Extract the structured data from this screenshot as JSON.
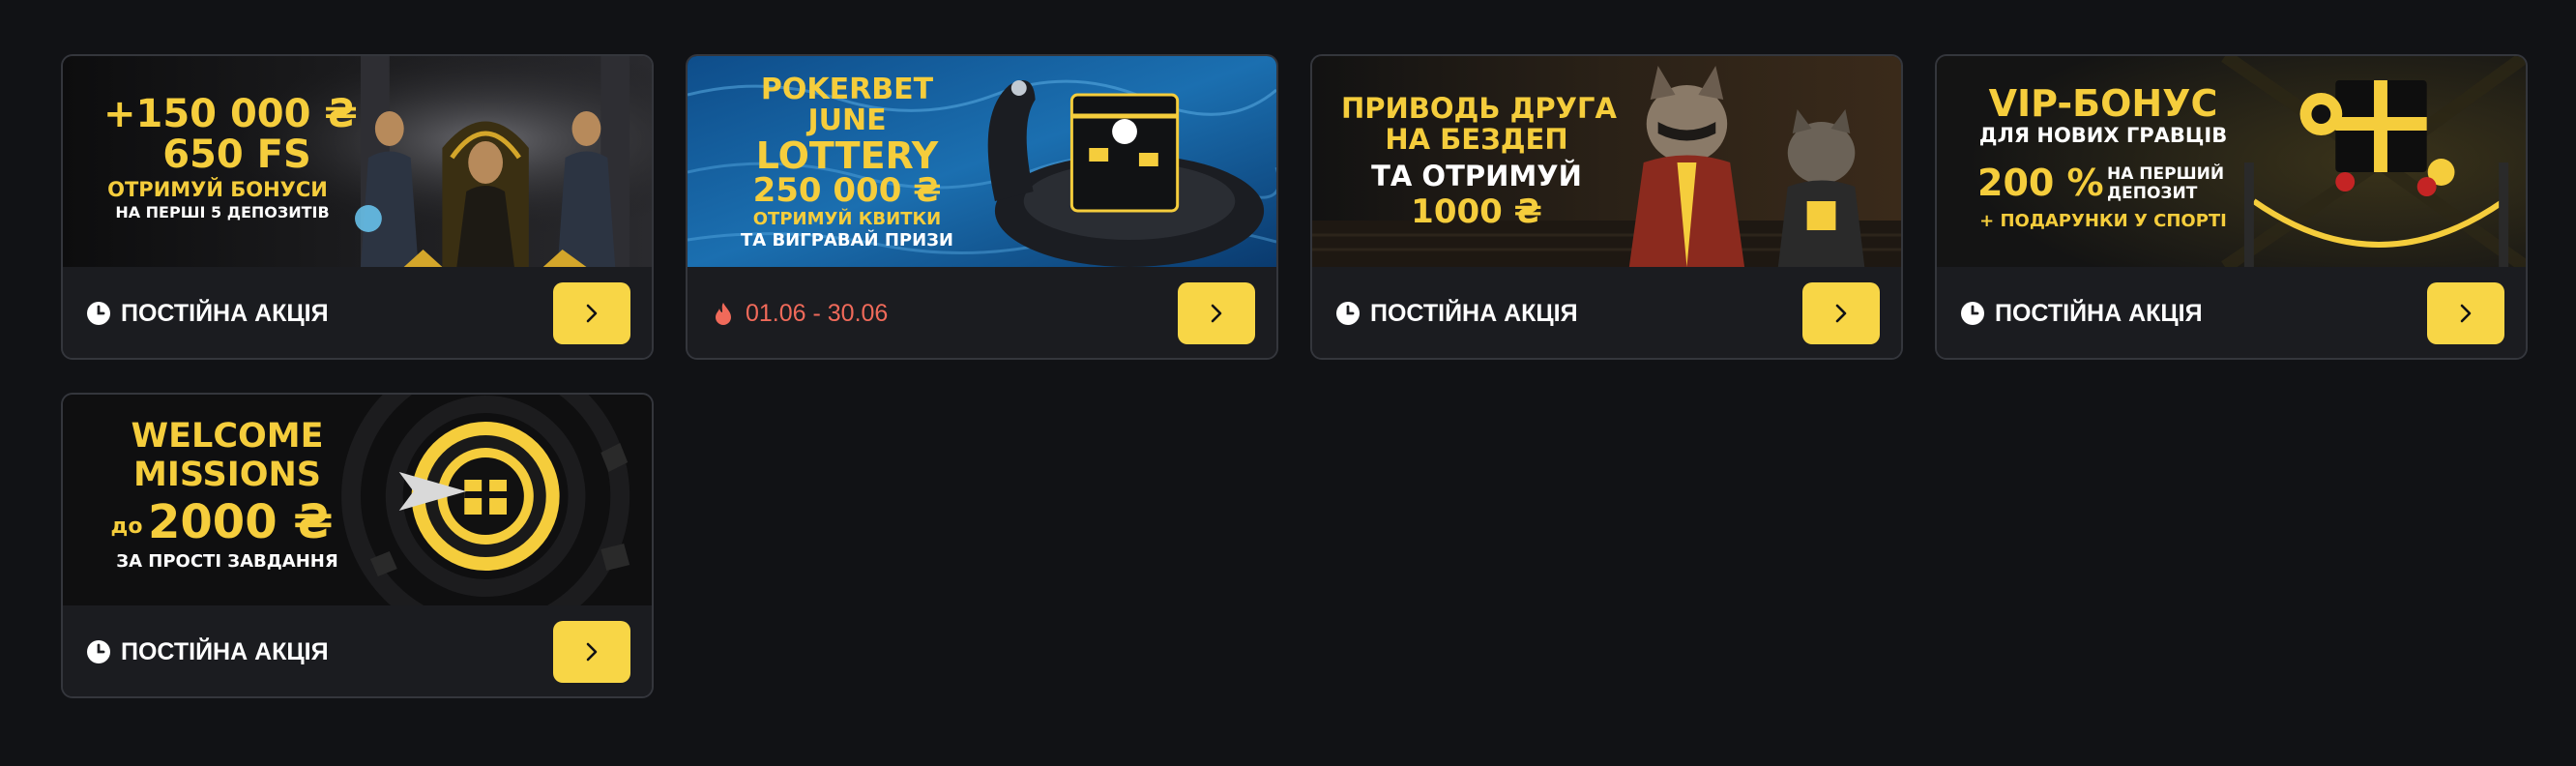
{
  "colors": {
    "background": "#111215",
    "card": "#1b1c20",
    "accent": "#f8d646",
    "date_text": "#f06a5a",
    "banner_gold": "#f5cd3c"
  },
  "promos": [
    {
      "banner": {
        "lines": [
          "+150 000 ₴",
          "650 FS",
          "ОТРИМУЙ БОНУСИ",
          "НА ПЕРШІ 5 ДЕПОЗИТІВ"
        ]
      },
      "status_icon": "clock-icon",
      "status": "ПОСТІЙНА АКЦІЯ",
      "button_icon": "chevron-right-icon"
    },
    {
      "banner": {
        "lines": [
          "POKERBET",
          "JUNE",
          "LOTTERY",
          "250 000 ₴",
          "ОТРИМУЙ КВИТКИ",
          "ТА ВИГРАВАЙ ПРИЗИ"
        ]
      },
      "status_icon": "flame-icon",
      "status": "01.06 - 30.06",
      "button_icon": "chevron-right-icon"
    },
    {
      "banner": {
        "lines": [
          "ПРИВОДЬ ДРУГА",
          "НА БЕЗДЕП",
          "ТА ОТРИМУЙ",
          "1000 ₴"
        ]
      },
      "status_icon": "clock-icon",
      "status": "ПОСТІЙНА АКЦІЯ",
      "button_icon": "chevron-right-icon"
    },
    {
      "banner": {
        "lines": [
          "VIP-БОНУС",
          "ДЛЯ НОВИХ ГРАВЦІВ",
          "200 %",
          "НА ПЕРШИЙ",
          "ДЕПОЗИТ",
          "+ ПОДАРУНКИ У СПОРТІ"
        ]
      },
      "status_icon": "clock-icon",
      "status": "ПОСТІЙНА АКЦІЯ",
      "button_icon": "chevron-right-icon"
    },
    {
      "banner": {
        "lines": [
          "WELCOME",
          "MISSIONS",
          "до",
          "2000 ₴",
          "ЗА ПРОСТІ ЗАВДАННЯ"
        ]
      },
      "status_icon": "clock-icon",
      "status": "ПОСТІЙНА АКЦІЯ",
      "button_icon": "chevron-right-icon"
    }
  ]
}
